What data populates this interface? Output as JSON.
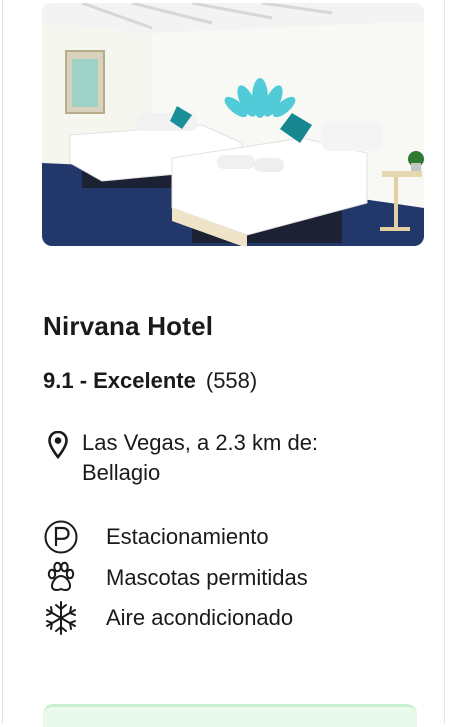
{
  "hotel": {
    "name": "Nirvana Hotel",
    "rating_value": "9.1 - Excelente",
    "rating_count": "(558)",
    "location_line1": "Las Vegas, a 2.3 km de:",
    "location_line2": "Bellagio"
  },
  "amenities": [
    {
      "label": "Estacionamiento",
      "icon": "parking-icon"
    },
    {
      "label": "Mascotas permitidas",
      "icon": "paw-icon"
    },
    {
      "label": "Aire acondicionado",
      "icon": "snowflake-icon"
    }
  ],
  "colors": {
    "text": "#1a1a1a",
    "card_border": "#e3e3e3",
    "cta_accent": "#c8efcf"
  }
}
